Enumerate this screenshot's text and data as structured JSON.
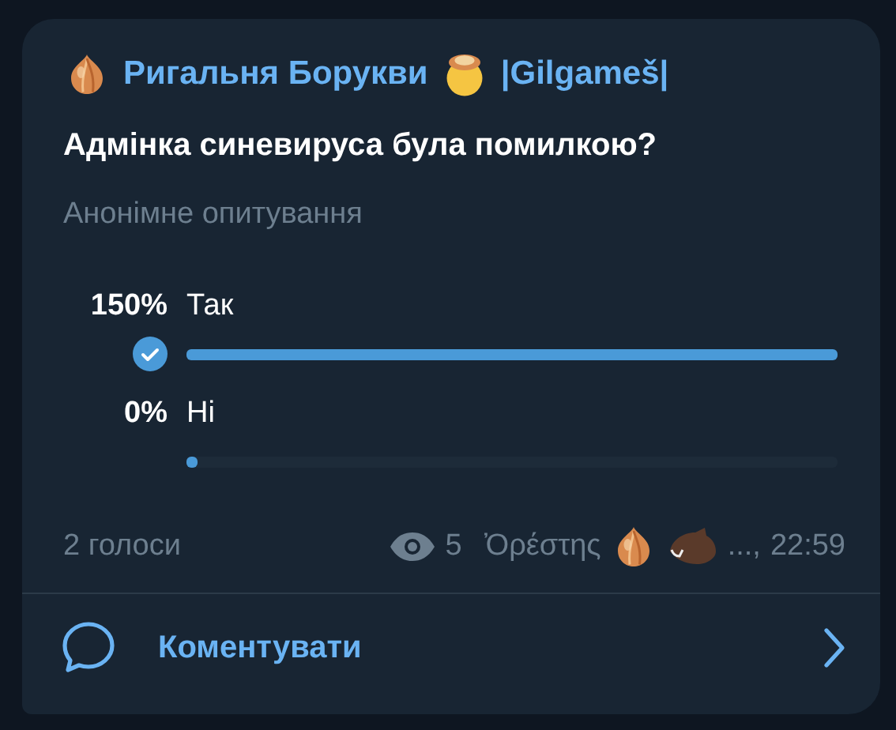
{
  "message": {
    "sender": {
      "name": "Ригальня Борукви",
      "suffix": "|Gilgameš|"
    },
    "poll": {
      "question": "Адмінка синевируса була помилкою?",
      "type_label": "Анонімне опитування",
      "options": [
        {
          "percent": "150%",
          "label": "Так",
          "level": 1,
          "selected": true
        },
        {
          "percent": "0%",
          "label": "Ні",
          "level": 0,
          "selected": false
        }
      ],
      "votes": "2 голоси"
    },
    "views": "5",
    "author": "Ὀρέστης",
    "author_tail": "...,",
    "time": "22:59"
  },
  "comments": {
    "label": "Коментувати"
  }
}
